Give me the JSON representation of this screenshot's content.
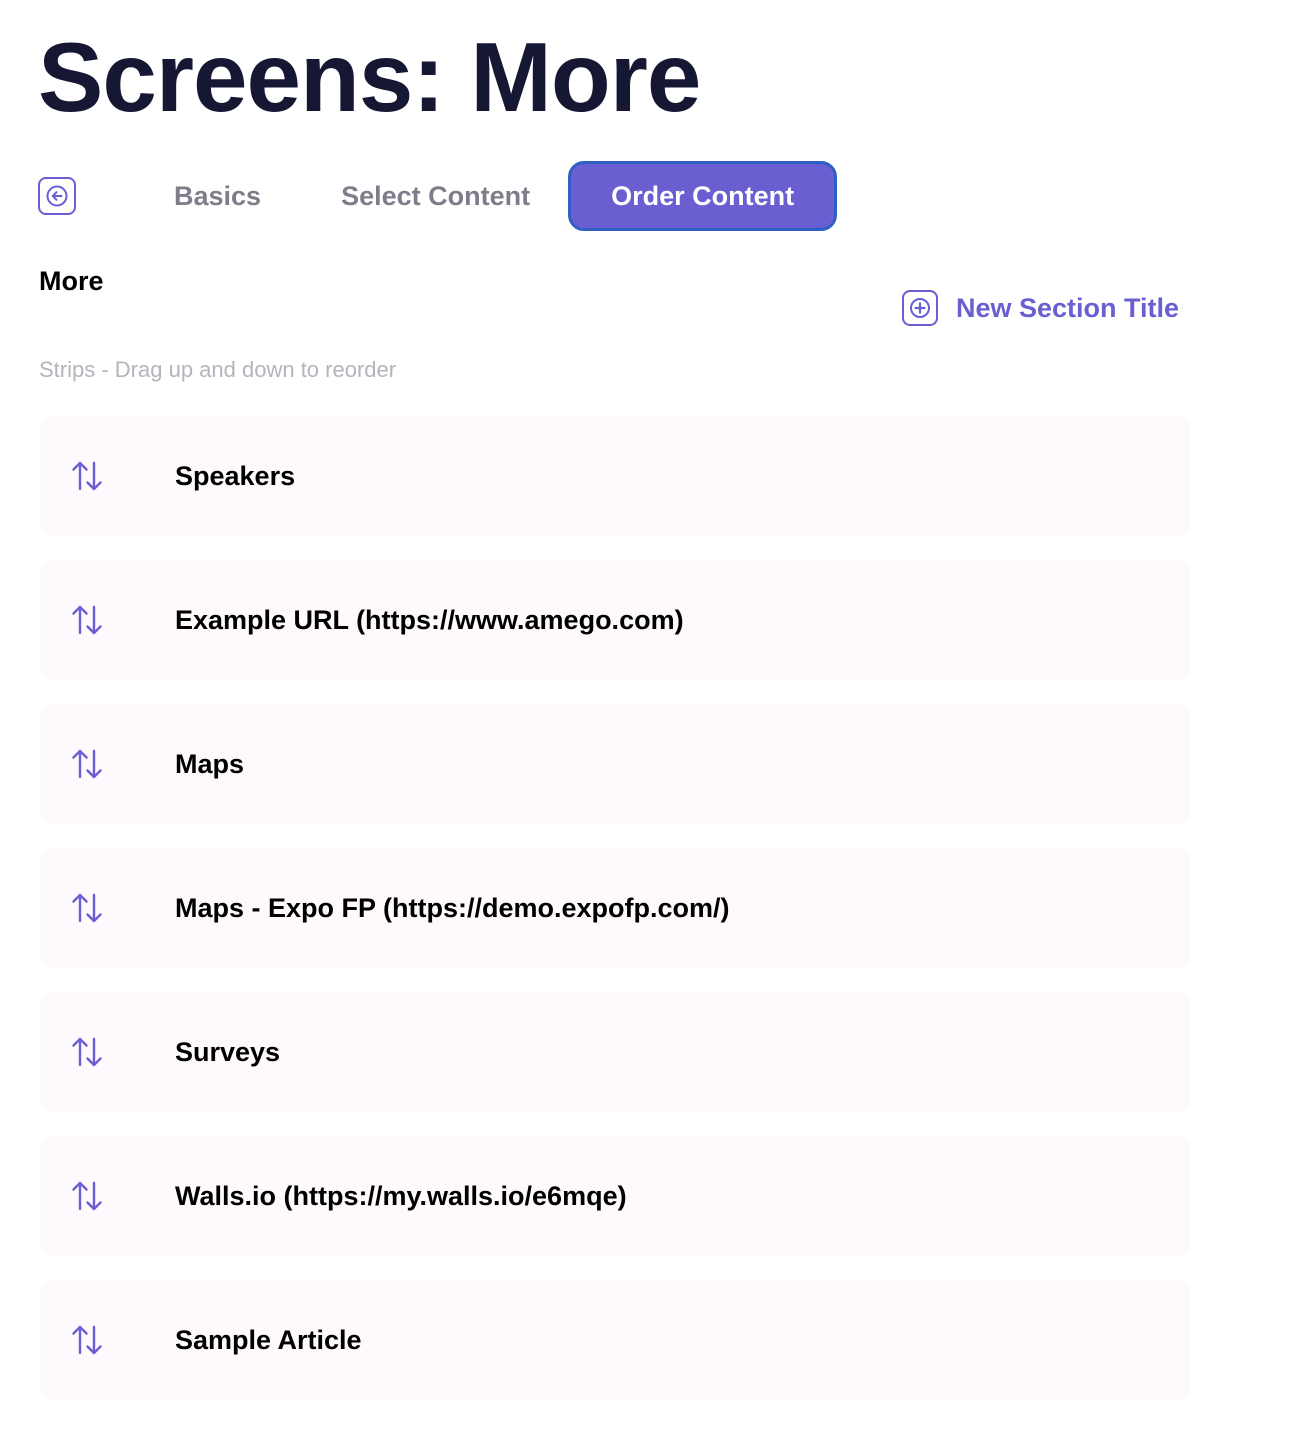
{
  "page": {
    "title": "Screens: More"
  },
  "tabs": {
    "back_icon": "arrow-left-icon",
    "items": [
      {
        "label": "Basics",
        "active": false
      },
      {
        "label": "Select Content",
        "active": false
      },
      {
        "label": "Order Content",
        "active": true
      }
    ]
  },
  "section": {
    "name": "More",
    "new_section_label": "New Section Title",
    "new_section_icon": "plus-square-icon",
    "hint": "Strips - Drag up and down to reorder"
  },
  "strips": [
    {
      "label": "Speakers"
    },
    {
      "label": "Example URL (https://www.amego.com)"
    },
    {
      "label": "Maps"
    },
    {
      "label": "Maps - Expo FP (https://demo.expofp.com/)"
    },
    {
      "label": "Surveys"
    },
    {
      "label": "Walls.io (https://my.walls.io/e6mqe)"
    },
    {
      "label": "Sample Article"
    }
  ],
  "colors": {
    "accent": "#6a5fd0",
    "title": "#151733",
    "inactive_tab": "#7d7e8a",
    "hint": "#b4b4bc",
    "strip_background": "#fdf9fc",
    "active_tab_border": "#2e5fc4"
  }
}
